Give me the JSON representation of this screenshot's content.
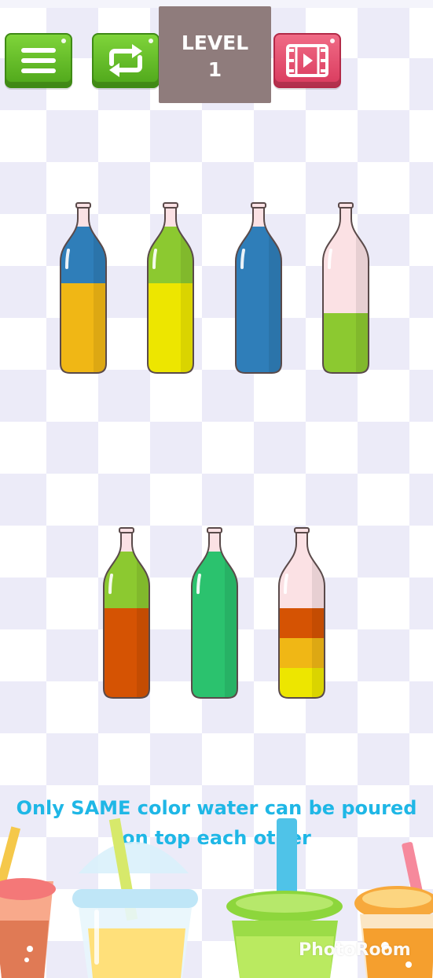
{
  "toolbar": {
    "menu_icon": "hamburger-menu-icon",
    "restart_icon": "restart-arrows-icon",
    "video_icon": "video-film-icon"
  },
  "level": {
    "label": "LEVEL",
    "number": "1"
  },
  "colors": {
    "blue": "#2f7eb9",
    "orange_yellow": "#f0b715",
    "yellow": "#ede600",
    "lime": "#8cc930",
    "red_orange": "#d55303",
    "green": "#2bc26e",
    "empty": "#fbe1e4"
  },
  "bottles": [
    {
      "id": 1,
      "layers_bottom_to_top": [
        "orange_yellow",
        "orange_yellow",
        "orange_yellow",
        "blue"
      ]
    },
    {
      "id": 2,
      "layers_bottom_to_top": [
        "yellow",
        "yellow",
        "yellow",
        "lime"
      ]
    },
    {
      "id": 3,
      "layers_bottom_to_top": [
        "blue",
        "blue",
        "blue",
        "blue"
      ]
    },
    {
      "id": 4,
      "layers_bottom_to_top": [
        "lime",
        "lime"
      ]
    },
    {
      "id": 5,
      "layers_bottom_to_top": [
        "red_orange",
        "red_orange",
        "red_orange",
        "lime"
      ]
    },
    {
      "id": 6,
      "layers_bottom_to_top": [
        "green",
        "green",
        "green",
        "green"
      ]
    },
    {
      "id": 7,
      "layers_bottom_to_top": [
        "yellow",
        "orange_yellow",
        "red_orange"
      ]
    }
  ],
  "hint": {
    "line1": "Only SAME color water can be poured",
    "line2": "on top each other"
  },
  "watermark": "PhotoRoom"
}
